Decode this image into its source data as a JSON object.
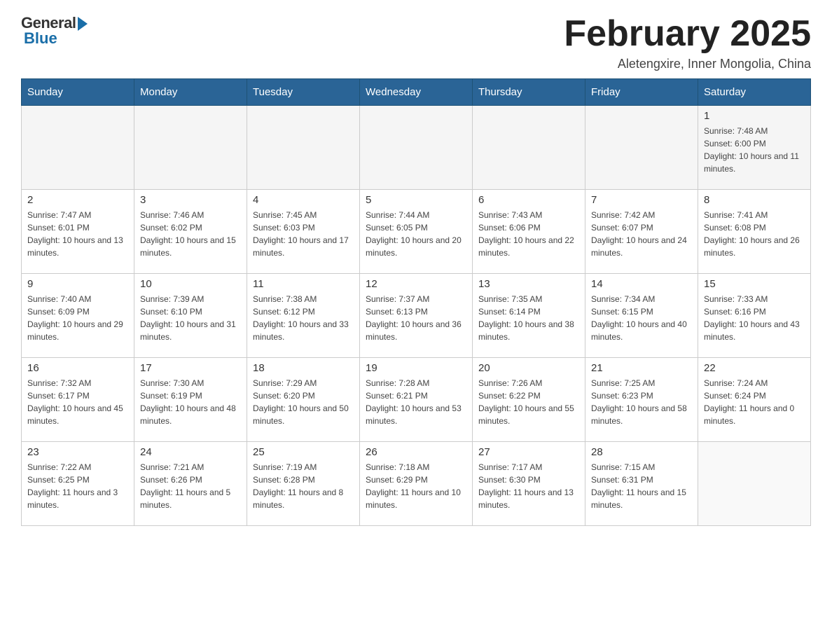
{
  "header": {
    "logo": {
      "general": "General",
      "blue": "Blue"
    },
    "title": "February 2025",
    "location": "Aletengxire, Inner Mongolia, China"
  },
  "days_of_week": [
    "Sunday",
    "Monday",
    "Tuesday",
    "Wednesday",
    "Thursday",
    "Friday",
    "Saturday"
  ],
  "weeks": [
    [
      {
        "day": "",
        "info": ""
      },
      {
        "day": "",
        "info": ""
      },
      {
        "day": "",
        "info": ""
      },
      {
        "day": "",
        "info": ""
      },
      {
        "day": "",
        "info": ""
      },
      {
        "day": "",
        "info": ""
      },
      {
        "day": "1",
        "info": "Sunrise: 7:48 AM\nSunset: 6:00 PM\nDaylight: 10 hours and 11 minutes."
      }
    ],
    [
      {
        "day": "2",
        "info": "Sunrise: 7:47 AM\nSunset: 6:01 PM\nDaylight: 10 hours and 13 minutes."
      },
      {
        "day": "3",
        "info": "Sunrise: 7:46 AM\nSunset: 6:02 PM\nDaylight: 10 hours and 15 minutes."
      },
      {
        "day": "4",
        "info": "Sunrise: 7:45 AM\nSunset: 6:03 PM\nDaylight: 10 hours and 17 minutes."
      },
      {
        "day": "5",
        "info": "Sunrise: 7:44 AM\nSunset: 6:05 PM\nDaylight: 10 hours and 20 minutes."
      },
      {
        "day": "6",
        "info": "Sunrise: 7:43 AM\nSunset: 6:06 PM\nDaylight: 10 hours and 22 minutes."
      },
      {
        "day": "7",
        "info": "Sunrise: 7:42 AM\nSunset: 6:07 PM\nDaylight: 10 hours and 24 minutes."
      },
      {
        "day": "8",
        "info": "Sunrise: 7:41 AM\nSunset: 6:08 PM\nDaylight: 10 hours and 26 minutes."
      }
    ],
    [
      {
        "day": "9",
        "info": "Sunrise: 7:40 AM\nSunset: 6:09 PM\nDaylight: 10 hours and 29 minutes."
      },
      {
        "day": "10",
        "info": "Sunrise: 7:39 AM\nSunset: 6:10 PM\nDaylight: 10 hours and 31 minutes."
      },
      {
        "day": "11",
        "info": "Sunrise: 7:38 AM\nSunset: 6:12 PM\nDaylight: 10 hours and 33 minutes."
      },
      {
        "day": "12",
        "info": "Sunrise: 7:37 AM\nSunset: 6:13 PM\nDaylight: 10 hours and 36 minutes."
      },
      {
        "day": "13",
        "info": "Sunrise: 7:35 AM\nSunset: 6:14 PM\nDaylight: 10 hours and 38 minutes."
      },
      {
        "day": "14",
        "info": "Sunrise: 7:34 AM\nSunset: 6:15 PM\nDaylight: 10 hours and 40 minutes."
      },
      {
        "day": "15",
        "info": "Sunrise: 7:33 AM\nSunset: 6:16 PM\nDaylight: 10 hours and 43 minutes."
      }
    ],
    [
      {
        "day": "16",
        "info": "Sunrise: 7:32 AM\nSunset: 6:17 PM\nDaylight: 10 hours and 45 minutes."
      },
      {
        "day": "17",
        "info": "Sunrise: 7:30 AM\nSunset: 6:19 PM\nDaylight: 10 hours and 48 minutes."
      },
      {
        "day": "18",
        "info": "Sunrise: 7:29 AM\nSunset: 6:20 PM\nDaylight: 10 hours and 50 minutes."
      },
      {
        "day": "19",
        "info": "Sunrise: 7:28 AM\nSunset: 6:21 PM\nDaylight: 10 hours and 53 minutes."
      },
      {
        "day": "20",
        "info": "Sunrise: 7:26 AM\nSunset: 6:22 PM\nDaylight: 10 hours and 55 minutes."
      },
      {
        "day": "21",
        "info": "Sunrise: 7:25 AM\nSunset: 6:23 PM\nDaylight: 10 hours and 58 minutes."
      },
      {
        "day": "22",
        "info": "Sunrise: 7:24 AM\nSunset: 6:24 PM\nDaylight: 11 hours and 0 minutes."
      }
    ],
    [
      {
        "day": "23",
        "info": "Sunrise: 7:22 AM\nSunset: 6:25 PM\nDaylight: 11 hours and 3 minutes."
      },
      {
        "day": "24",
        "info": "Sunrise: 7:21 AM\nSunset: 6:26 PM\nDaylight: 11 hours and 5 minutes."
      },
      {
        "day": "25",
        "info": "Sunrise: 7:19 AM\nSunset: 6:28 PM\nDaylight: 11 hours and 8 minutes."
      },
      {
        "day": "26",
        "info": "Sunrise: 7:18 AM\nSunset: 6:29 PM\nDaylight: 11 hours and 10 minutes."
      },
      {
        "day": "27",
        "info": "Sunrise: 7:17 AM\nSunset: 6:30 PM\nDaylight: 11 hours and 13 minutes."
      },
      {
        "day": "28",
        "info": "Sunrise: 7:15 AM\nSunset: 6:31 PM\nDaylight: 11 hours and 15 minutes."
      },
      {
        "day": "",
        "info": ""
      }
    ]
  ]
}
